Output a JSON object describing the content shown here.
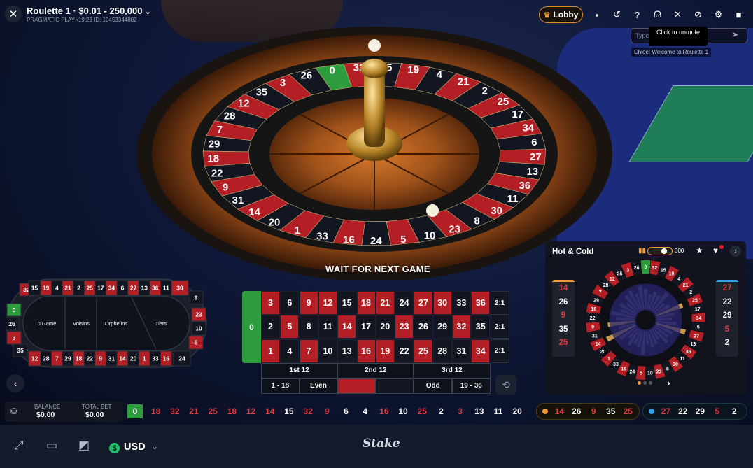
{
  "header": {
    "close_icon": "close-icon",
    "title": "Roulette 1 · $0.01 - 250,000",
    "title_chevron": "⌄",
    "subtitle": "PRAGMATIC PLAY •19:23 ID: 10453344802",
    "lobby_label": "Lobby",
    "icons": [
      "chat-icon",
      "history-icon",
      "help-icon",
      "support-icon",
      "mute-icon",
      "video-off-icon",
      "settings-icon",
      "camera-icon"
    ]
  },
  "chat": {
    "input_placeholder": "Type",
    "tooltip": "Click to unmute",
    "message": "Chloe: Welcome to Roulette 1"
  },
  "game_status": "WAIT FOR NEXT GAME",
  "racetrack": {
    "sections": [
      "0 Game",
      "Voisins",
      "Orphelins",
      "Tiers"
    ],
    "top_numbers": [
      "19",
      "4",
      "21",
      "2",
      "25",
      "17",
      "34",
      "6",
      "27",
      "13",
      "36",
      "11"
    ],
    "bottom_numbers": [
      "28",
      "7",
      "29",
      "18",
      "22",
      "9",
      "31",
      "14",
      "20",
      "1",
      "33",
      "16"
    ],
    "left_numbers": [
      "32",
      "0",
      "26",
      "3",
      "35",
      "12",
      "15"
    ],
    "right_numbers": [
      "30",
      "8",
      "23",
      "10",
      "5",
      "24"
    ]
  },
  "bet_table": {
    "zero": "0",
    "rows": [
      [
        "3",
        "6",
        "9",
        "12",
        "15",
        "18",
        "21",
        "24",
        "27",
        "30",
        "33",
        "36"
      ],
      [
        "2",
        "5",
        "8",
        "11",
        "14",
        "17",
        "20",
        "23",
        "26",
        "29",
        "32",
        "35"
      ],
      [
        "1",
        "4",
        "7",
        "10",
        "13",
        "16",
        "19",
        "22",
        "25",
        "28",
        "31",
        "34"
      ]
    ],
    "red_numbers": [
      "1",
      "3",
      "5",
      "7",
      "9",
      "12",
      "14",
      "16",
      "18",
      "19",
      "21",
      "23",
      "25",
      "27",
      "30",
      "32",
      "34",
      "36"
    ],
    "column_bets": [
      "2:1",
      "2:1",
      "2:1"
    ],
    "dozens": [
      "1st 12",
      "2nd 12",
      "3rd 12"
    ],
    "outside": [
      "1 - 18",
      "Even",
      "",
      "",
      "Odd",
      "19 - 36"
    ]
  },
  "hot_cold": {
    "title": "Hot & Cold",
    "round_count": "300",
    "hot": [
      "14",
      "26",
      "9",
      "35",
      "25"
    ],
    "cold": [
      "27",
      "22",
      "29",
      "5",
      "2"
    ],
    "wheel_numbers": [
      "0",
      "32",
      "15",
      "19",
      "4",
      "21",
      "2",
      "25",
      "17",
      "34",
      "6",
      "27",
      "13",
      "36",
      "11",
      "30",
      "8",
      "23",
      "10",
      "5",
      "24",
      "16",
      "33",
      "1",
      "20",
      "14",
      "31",
      "9",
      "22",
      "18",
      "29",
      "7",
      "28",
      "12",
      "35",
      "3",
      "26"
    ],
    "bar_levels": [
      0.6,
      0.45,
      0.55,
      0.5,
      0.7,
      0.4,
      0.5,
      0.85,
      0.55,
      0.45,
      0.6,
      0.9,
      0.55,
      0.5,
      0.6,
      0.35,
      0.45,
      0.5,
      0.4,
      0.7,
      0.5,
      0.45,
      0.55,
      0.4,
      0.6,
      0.95,
      0.5,
      0.8,
      0.55,
      0.7,
      0.45,
      0.55,
      0.4,
      0.6,
      0.65,
      0.5,
      0.7
    ],
    "page_dots": 3,
    "active_dot": 0
  },
  "balance": {
    "balance_label": "BALANCE",
    "balance_value": "$0.00",
    "total_bet_label": "TOTAL BET",
    "total_bet_value": "$0.00"
  },
  "last_results": [
    {
      "n": "0",
      "c": "green"
    },
    {
      "n": "18",
      "c": "red"
    },
    {
      "n": "32",
      "c": "red"
    },
    {
      "n": "21",
      "c": "red"
    },
    {
      "n": "25",
      "c": "red"
    },
    {
      "n": "18",
      "c": "red"
    },
    {
      "n": "12",
      "c": "red"
    },
    {
      "n": "14",
      "c": "red"
    },
    {
      "n": "15",
      "c": "black"
    },
    {
      "n": "32",
      "c": "red"
    },
    {
      "n": "9",
      "c": "red"
    },
    {
      "n": "6",
      "c": "black"
    },
    {
      "n": "4",
      "c": "black"
    },
    {
      "n": "16",
      "c": "red"
    },
    {
      "n": "10",
      "c": "black"
    },
    {
      "n": "25",
      "c": "red"
    },
    {
      "n": "2",
      "c": "black"
    },
    {
      "n": "3",
      "c": "red"
    },
    {
      "n": "13",
      "c": "black"
    },
    {
      "n": "11",
      "c": "black"
    },
    {
      "n": "20",
      "c": "black"
    }
  ],
  "hot_strip": [
    {
      "n": "14",
      "c": "red"
    },
    {
      "n": "26",
      "c": "black"
    },
    {
      "n": "9",
      "c": "red"
    },
    {
      "n": "35",
      "c": "black"
    },
    {
      "n": "25",
      "c": "red"
    }
  ],
  "cold_strip": [
    {
      "n": "27",
      "c": "red"
    },
    {
      "n": "22",
      "c": "black"
    },
    {
      "n": "29",
      "c": "black"
    },
    {
      "n": "5",
      "c": "red"
    },
    {
      "n": "2",
      "c": "black"
    }
  ],
  "bottom_bar": {
    "currency": "USD",
    "currency_symbol": "$",
    "brand": "Stake"
  },
  "colors": {
    "red": "#b31f25",
    "black": "#121620",
    "green": "#2d9c3c",
    "hot": "#f29a36",
    "cold": "#2ba4e6"
  }
}
